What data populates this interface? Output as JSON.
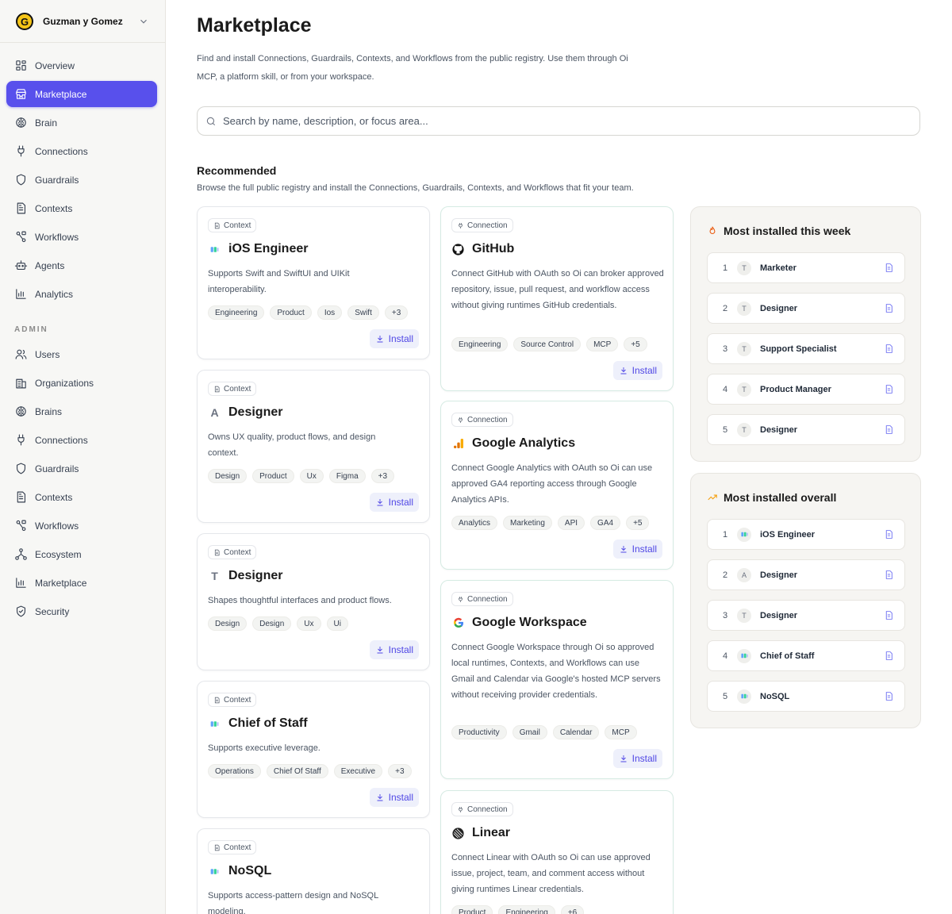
{
  "org": {
    "name": "Guzman y Gomez",
    "logo_letter": "G"
  },
  "nav": [
    {
      "label": "Overview",
      "icon": "overview-icon"
    },
    {
      "label": "Marketplace",
      "icon": "store-icon",
      "active": true
    },
    {
      "label": "Brain",
      "icon": "brain-icon"
    },
    {
      "label": "Connections",
      "icon": "plug-icon"
    },
    {
      "label": "Guardrails",
      "icon": "shield-icon"
    },
    {
      "label": "Contexts",
      "icon": "document-icon"
    },
    {
      "label": "Workflows",
      "icon": "workflow-icon"
    },
    {
      "label": "Agents",
      "icon": "bot-icon"
    },
    {
      "label": "Analytics",
      "icon": "bar-chart-icon"
    }
  ],
  "admin_label": "ADMIN",
  "admin_nav": [
    {
      "label": "Users",
      "icon": "users-icon"
    },
    {
      "label": "Organizations",
      "icon": "building-icon"
    },
    {
      "label": "Brains",
      "icon": "brain-icon"
    },
    {
      "label": "Connections",
      "icon": "plug-icon"
    },
    {
      "label": "Guardrails",
      "icon": "shield-icon"
    },
    {
      "label": "Contexts",
      "icon": "document-icon"
    },
    {
      "label": "Workflows",
      "icon": "workflow-icon"
    },
    {
      "label": "Ecosystem",
      "icon": "network-icon"
    },
    {
      "label": "Marketplace",
      "icon": "bar-chart-icon"
    },
    {
      "label": "Security",
      "icon": "shield-check-icon"
    }
  ],
  "page": {
    "title": "Marketplace",
    "description": "Find and install Connections, Guardrails, Contexts, and Workflows from the public registry. Use them through Oi MCP, a platform skill, or from your workspace.",
    "search_placeholder": "Search by name, description, or focus area...",
    "recommended_title": "Recommended",
    "recommended_desc": "Browse the full public registry and install the Connections, Guardrails, Contexts, and Workflows that fit your team."
  },
  "install_label": "Install",
  "left_cards": [
    {
      "badge": "Context",
      "title": "iOS Engineer",
      "icon": "squares",
      "desc": "Supports Swift and SwiftUI and UIKit interoperability.",
      "tags": [
        "Engineering",
        "Product",
        "Ios",
        "Swift",
        "+3"
      ]
    },
    {
      "badge": "Context",
      "title": "Designer",
      "icon": "A",
      "desc": "Owns UX quality, product flows, and design context.",
      "tags": [
        "Design",
        "Product",
        "Ux",
        "Figma",
        "+3"
      ]
    },
    {
      "badge": "Context",
      "title": "Designer",
      "icon": "T",
      "desc": "Shapes thoughtful interfaces and product flows.",
      "tags": [
        "Design",
        "Design",
        "Ux",
        "Ui"
      ]
    },
    {
      "badge": "Context",
      "title": "Chief of Staff",
      "icon": "squares",
      "desc": "Supports executive leverage.",
      "tags": [
        "Operations",
        "Chief Of Staff",
        "Executive",
        "+3"
      ]
    },
    {
      "badge": "Context",
      "title": "NoSQL",
      "icon": "squares",
      "desc": "Supports access-pattern design and NoSQL modeling.",
      "tags": []
    }
  ],
  "right_cards": [
    {
      "badge": "Connection",
      "title": "GitHub",
      "icon": "github",
      "desc": "Connect GitHub with OAuth so Oi can broker approved repository, issue, pull request, and workflow access without giving runtimes GitHub credentials.",
      "tags": [
        "Engineering",
        "Source Control",
        "MCP",
        "+5"
      ]
    },
    {
      "badge": "Connection",
      "title": "Google Analytics",
      "icon": "ganalytics",
      "desc": "Connect Google Analytics with OAuth so Oi can use approved GA4 reporting access through Google Analytics APIs.",
      "tags": [
        "Analytics",
        "Marketing",
        "API",
        "GA4",
        "+5"
      ]
    },
    {
      "badge": "Connection",
      "title": "Google Workspace",
      "icon": "google",
      "desc": "Connect Google Workspace through Oi so approved local runtimes, Contexts, and Workflows can use Gmail and Calendar via Google's hosted MCP servers without receiving provider credentials.",
      "tags": [
        "Productivity",
        "Gmail",
        "Calendar",
        "MCP"
      ]
    },
    {
      "badge": "Connection",
      "title": "Linear",
      "icon": "linear",
      "desc": "Connect Linear with OAuth so Oi can use approved issue, project, team, and comment access without giving runtimes Linear credentials.",
      "tags": [
        "Product",
        "Engineering",
        "+6"
      ]
    }
  ],
  "week_panel": {
    "title": "Most installed this week",
    "items": [
      {
        "rank": "1",
        "avatar": "T",
        "name": "Marketer"
      },
      {
        "rank": "2",
        "avatar": "T",
        "name": "Designer"
      },
      {
        "rank": "3",
        "avatar": "T",
        "name": "Support Specialist"
      },
      {
        "rank": "4",
        "avatar": "T",
        "name": "Product Manager"
      },
      {
        "rank": "5",
        "avatar": "T",
        "name": "Designer"
      }
    ]
  },
  "overall_panel": {
    "title": "Most installed overall",
    "items": [
      {
        "rank": "1",
        "avatar": "squares",
        "name": "iOS Engineer"
      },
      {
        "rank": "2",
        "avatar": "A",
        "name": "Designer"
      },
      {
        "rank": "3",
        "avatar": "T",
        "name": "Designer"
      },
      {
        "rank": "4",
        "avatar": "squares",
        "name": "Chief of Staff"
      },
      {
        "rank": "5",
        "avatar": "squares",
        "name": "NoSQL"
      }
    ]
  }
}
